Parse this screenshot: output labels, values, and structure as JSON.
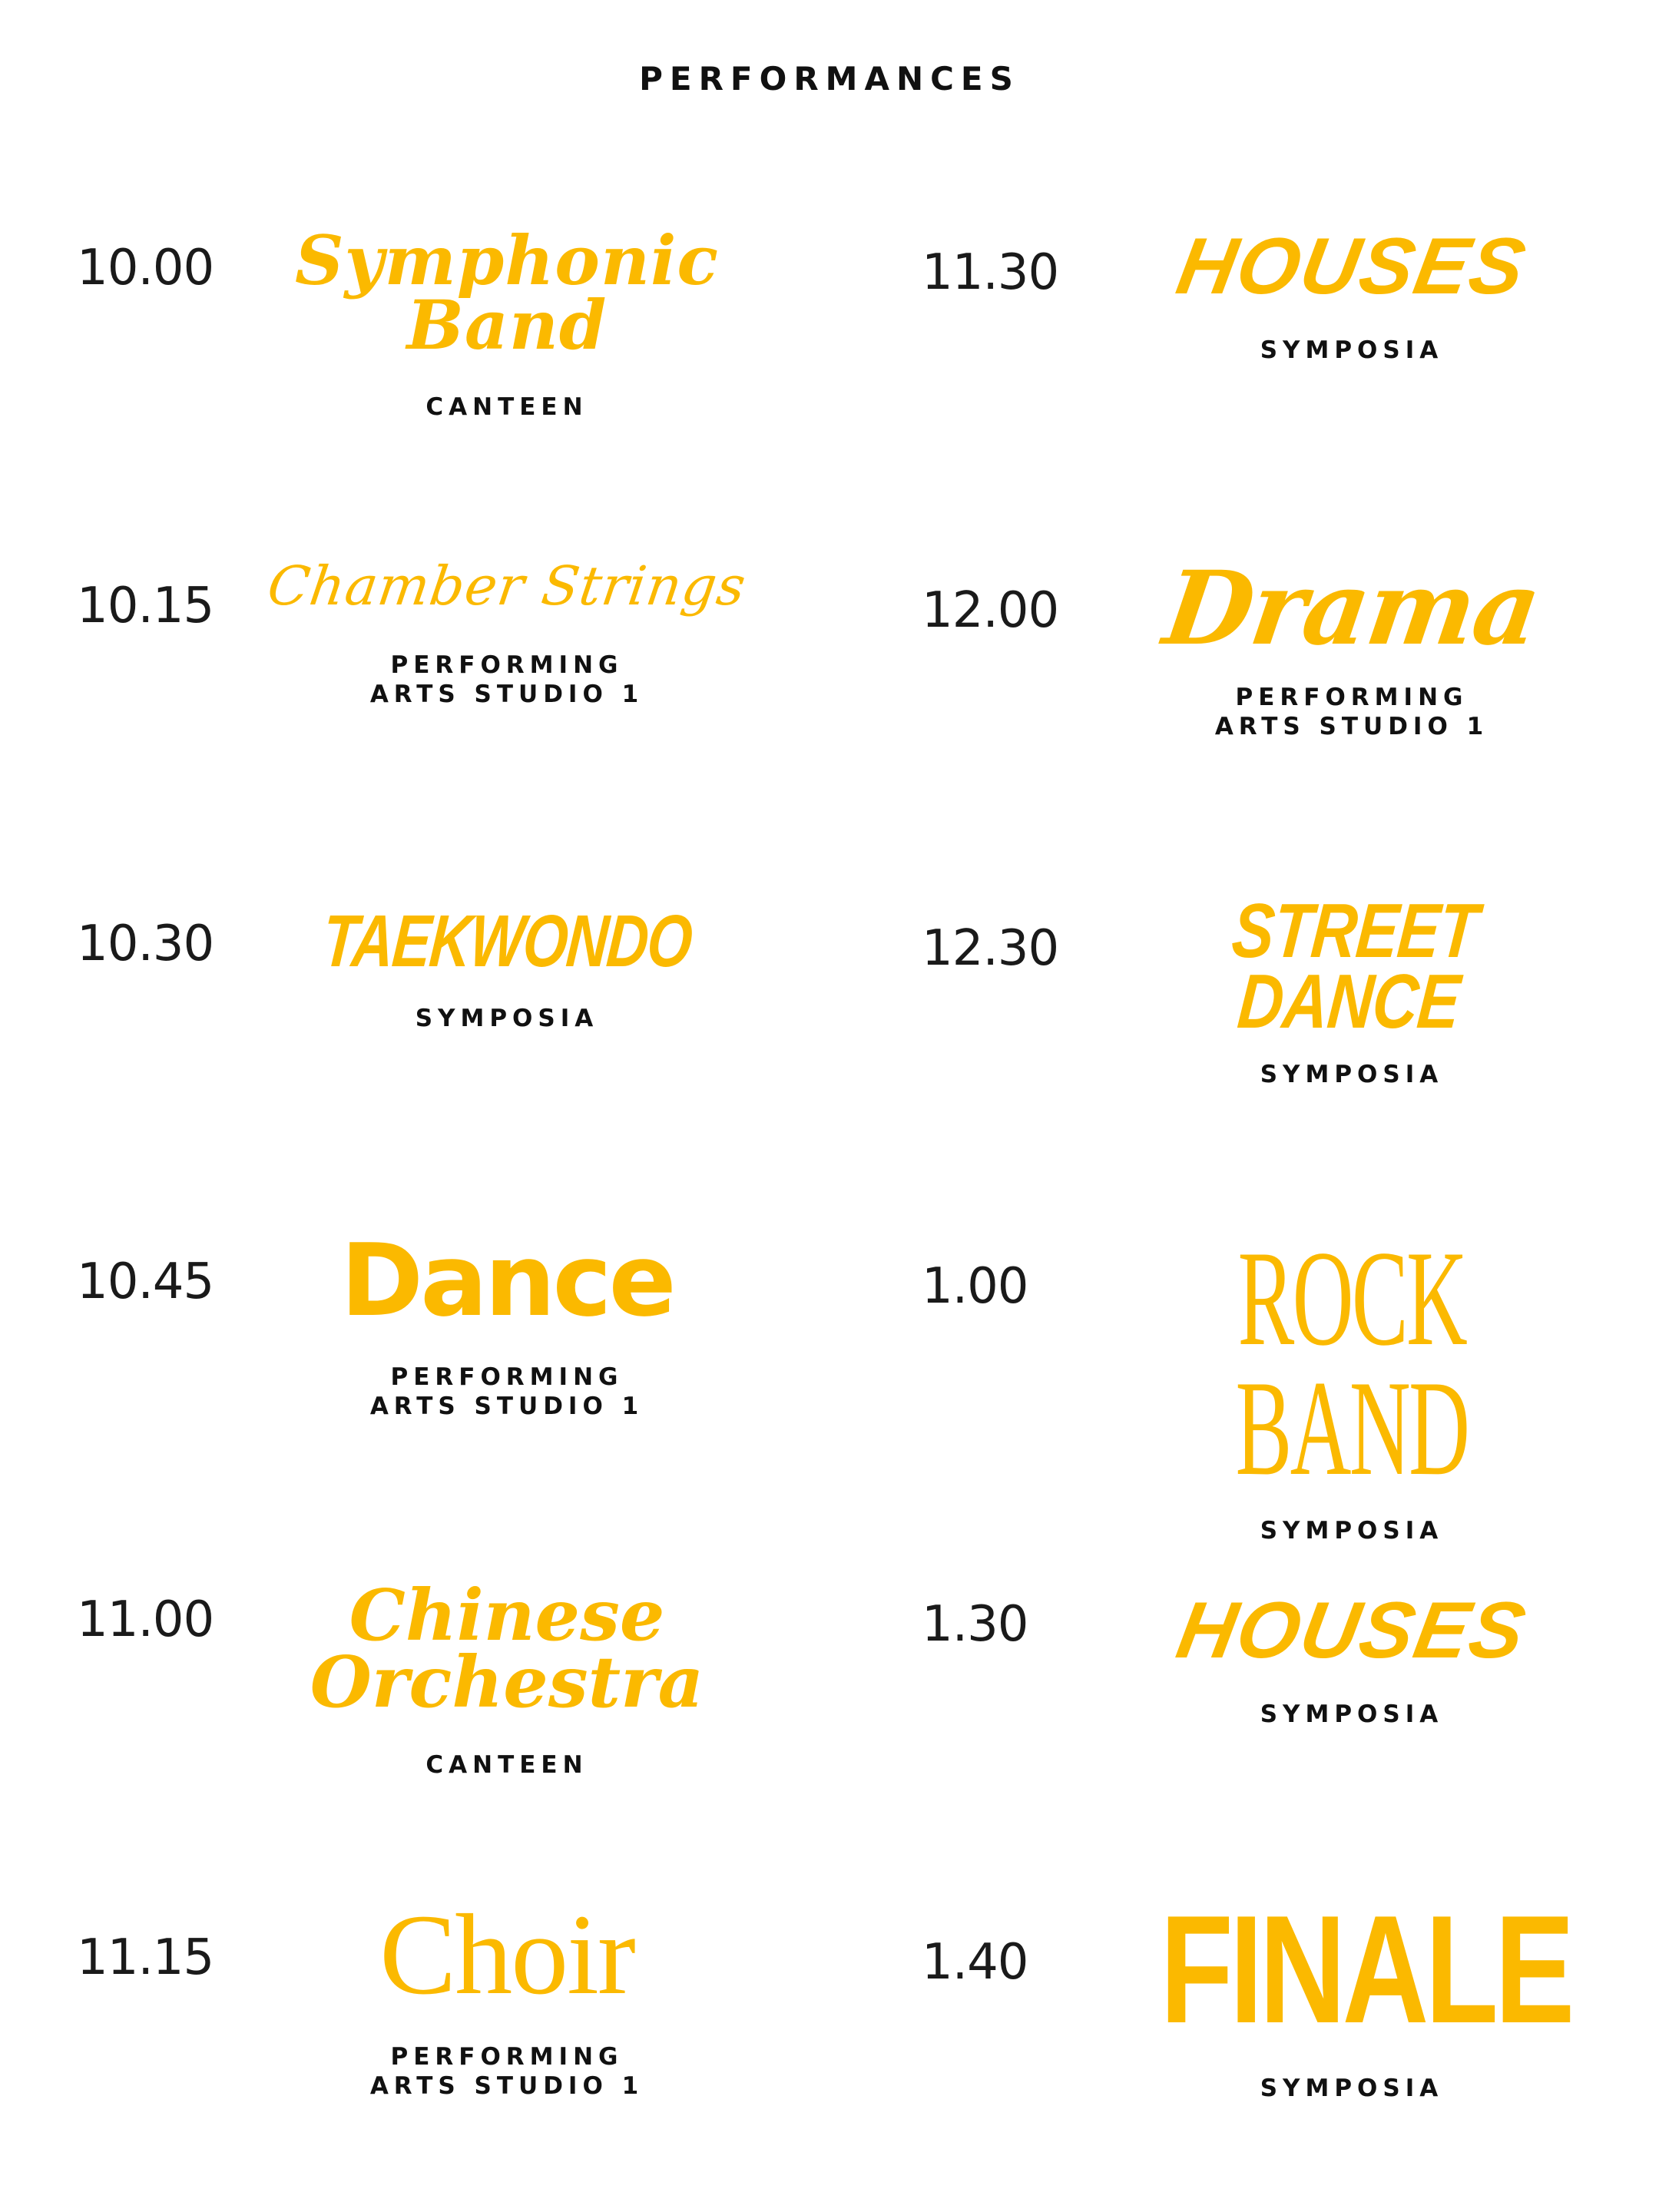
{
  "page": {
    "title": "PERFORMANCES"
  },
  "colors": {
    "accent": "#fbb900",
    "text": "#111111",
    "background": "#ffffff"
  },
  "schedule": {
    "left": [
      {
        "time": "10.00",
        "event": "Symphonic\nBand",
        "venue": "CANTEEN"
      },
      {
        "time": "10.15",
        "event": "Chamber Strings",
        "venue": "PERFORMING\nARTS STUDIO 1"
      },
      {
        "time": "10.30",
        "event": "TAEKWONDO",
        "venue": "SYMPOSIA"
      },
      {
        "time": "10.45",
        "event": "Dance",
        "venue": "PERFORMING\nARTS STUDIO 1"
      },
      {
        "time": "11.00",
        "event": "Chinese\nOrchestra",
        "venue": "CANTEEN"
      },
      {
        "time": "11.15",
        "event": "Choir",
        "venue": "PERFORMING\nARTS STUDIO 1"
      }
    ],
    "right": [
      {
        "time": "11.30",
        "event": "HOUSES",
        "venue": "SYMPOSIA"
      },
      {
        "time": "12.00",
        "event": "Drama",
        "venue": "PERFORMING\nARTS STUDIO 1"
      },
      {
        "time": "12.30",
        "event": "STREET\nDANCE",
        "venue": "SYMPOSIA"
      },
      {
        "time": "1.00",
        "event": "ROCK BAND",
        "venue": "SYMPOSIA"
      },
      {
        "time": "1.30",
        "event": "HOUSES",
        "venue": "SYMPOSIA"
      },
      {
        "time": "1.40",
        "event": "FINALE",
        "venue": "SYMPOSIA"
      }
    ]
  }
}
